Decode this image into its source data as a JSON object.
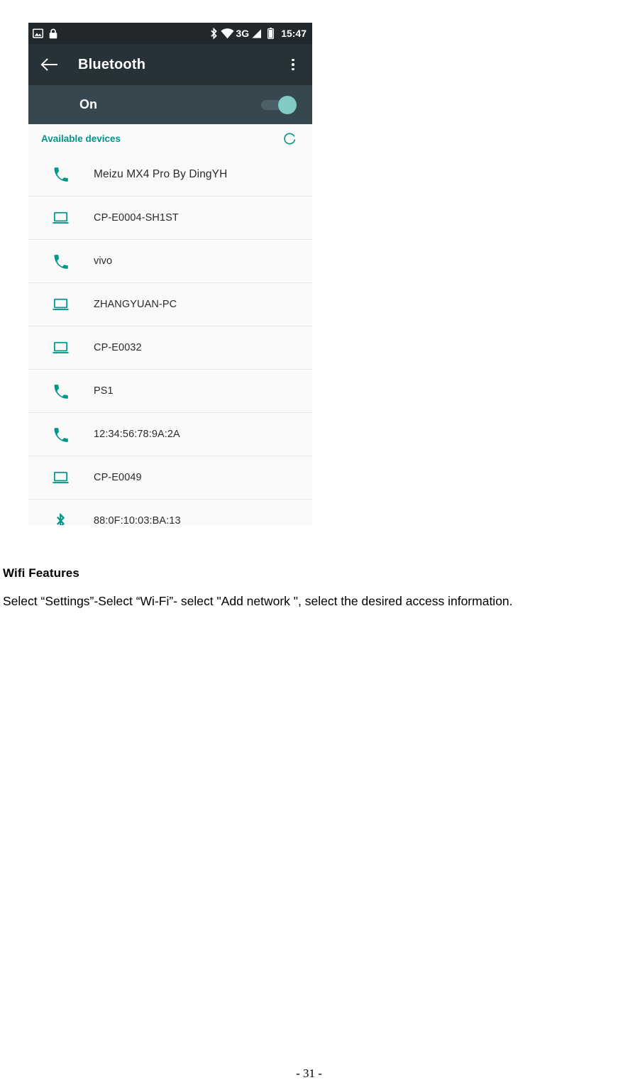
{
  "phone": {
    "status_bar": {
      "left_icons": [
        "screenshot-icon",
        "lock-icon"
      ],
      "bluetooth_icon": "bluetooth-icon",
      "wifi_icon": "wifi-icon",
      "network_label": "3G",
      "signal_icon": "signal-icon",
      "battery_icon": "battery-icon",
      "clock": "15:47"
    },
    "app_bar": {
      "back_icon": "back-arrow-icon",
      "title": "Bluetooth",
      "overflow_icon": "overflow-menu-icon"
    },
    "toggle_row": {
      "state_label": "On",
      "switch_on": true
    },
    "section": {
      "label": "Available devices",
      "refresh_icon": "scanning-spinner-icon"
    },
    "devices": [
      {
        "name": "Meizu MX4 Pro By DingYH",
        "icon": "phone-icon"
      },
      {
        "name": "CP-E0004-SH1ST",
        "icon": "laptop-icon"
      },
      {
        "name": "vivo",
        "icon": "phone-icon"
      },
      {
        "name": "ZHANGYUAN-PC",
        "icon": "laptop-icon"
      },
      {
        "name": "CP-E0032",
        "icon": "laptop-icon"
      },
      {
        "name": "PS1",
        "icon": "phone-icon"
      },
      {
        "name": "12:34:56:78:9A:2A",
        "icon": "phone-icon"
      },
      {
        "name": "CP-E0049",
        "icon": "laptop-icon"
      },
      {
        "name": "88:0F:10:03:BA:13",
        "icon": "bluetooth-icon"
      }
    ],
    "colors": {
      "app_bar": "#263238",
      "status_bar": "#22282c",
      "toggle_row": "#37474f",
      "accent": "#009688",
      "switch_thumb": "#80cbc4",
      "list_background": "#fafafa"
    }
  },
  "document": {
    "heading": "Wifi Features",
    "body": "Select “Settings”-Select “Wi-Fi”- select \"Add network \", select the desired access information.",
    "page_number": "- 31 -"
  }
}
